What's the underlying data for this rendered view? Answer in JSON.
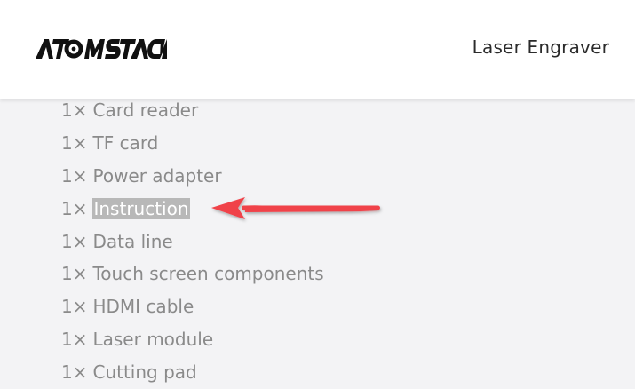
{
  "header": {
    "brand_logo_text": "ATOMSTACK",
    "title": "Laser Engraver"
  },
  "items": [
    {
      "qty": "1×",
      "name": "Card reader"
    },
    {
      "qty": "1×",
      "name": "TF card"
    },
    {
      "qty": "1×",
      "name": "Power adapter"
    },
    {
      "qty": "1×",
      "name": "Instruction",
      "highlighted": true
    },
    {
      "qty": "1×",
      "name": "Data line"
    },
    {
      "qty": "1×",
      "name": "Touch screen components"
    },
    {
      "qty": "1×",
      "name": "HDMI cable"
    },
    {
      "qty": "1×",
      "name": "Laser module"
    },
    {
      "qty": "1×",
      "name": "Cutting pad"
    }
  ],
  "annotation": {
    "arrow_color": "#f0424a",
    "points_to": "Instruction"
  },
  "colors": {
    "header_bg": "#ffffff",
    "page_bg": "#f3f3f5",
    "item_text": "#8a8a8a",
    "highlight_bg": "#b8b8b8"
  }
}
